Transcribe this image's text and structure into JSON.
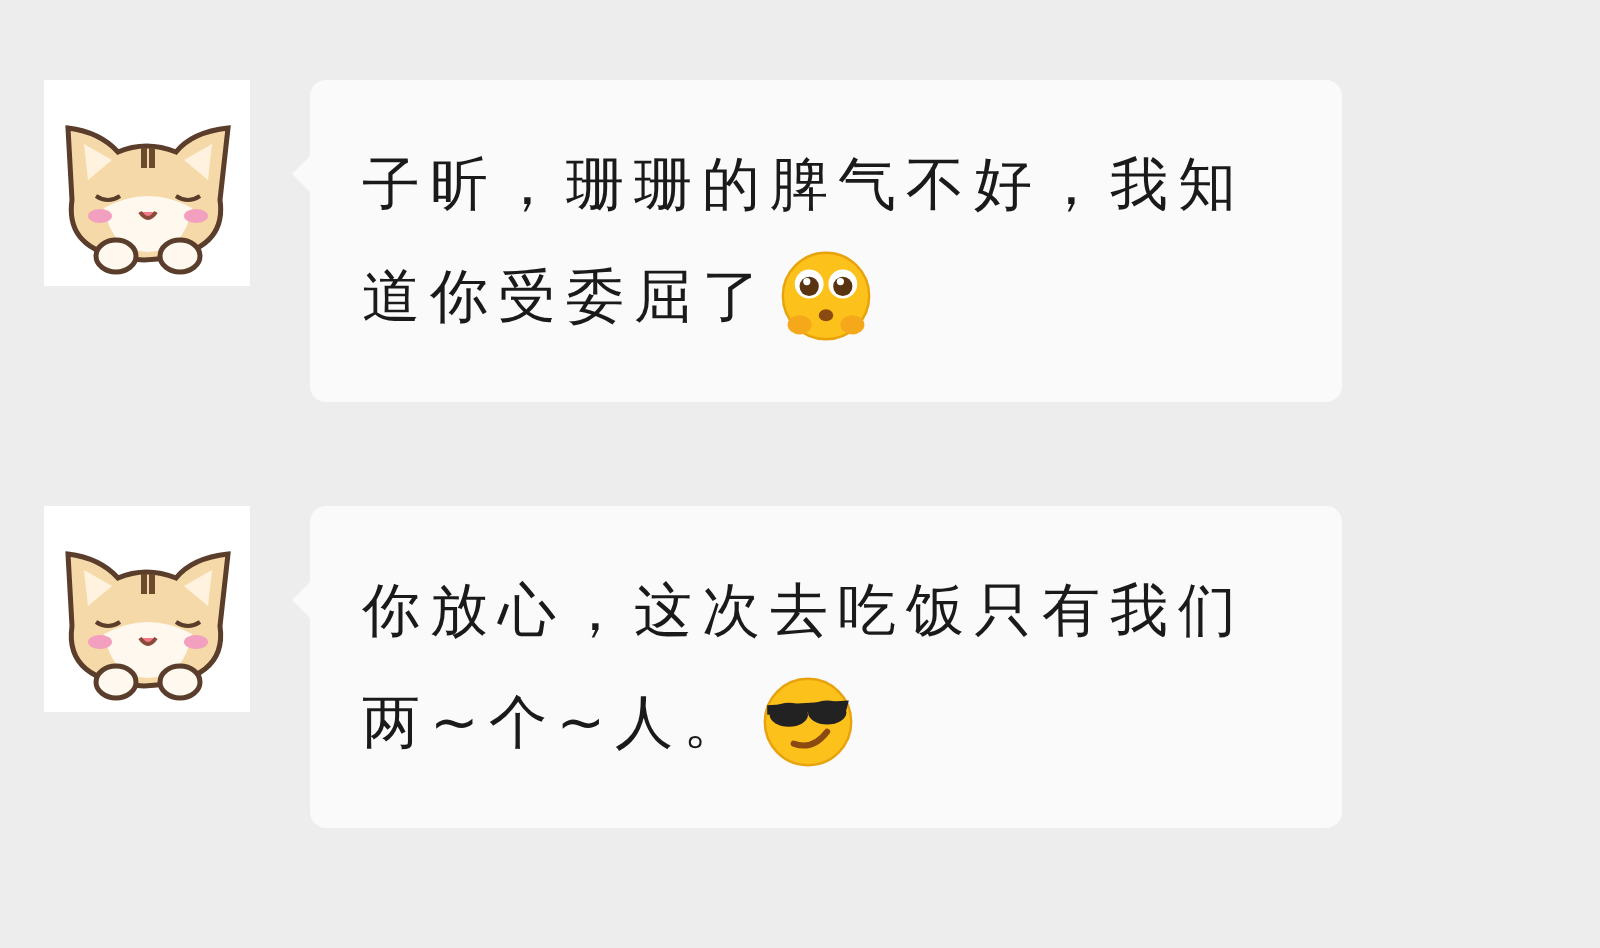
{
  "messages": [
    {
      "lines": [
        "子昕，珊珊的脾气不好，我知",
        "道你受委屈了"
      ],
      "kind": "pleading"
    },
    {
      "lines": [
        "你放心，这次去吃饭只有我们",
        "两~个~人。"
      ],
      "kind": "sunglasses"
    }
  ]
}
